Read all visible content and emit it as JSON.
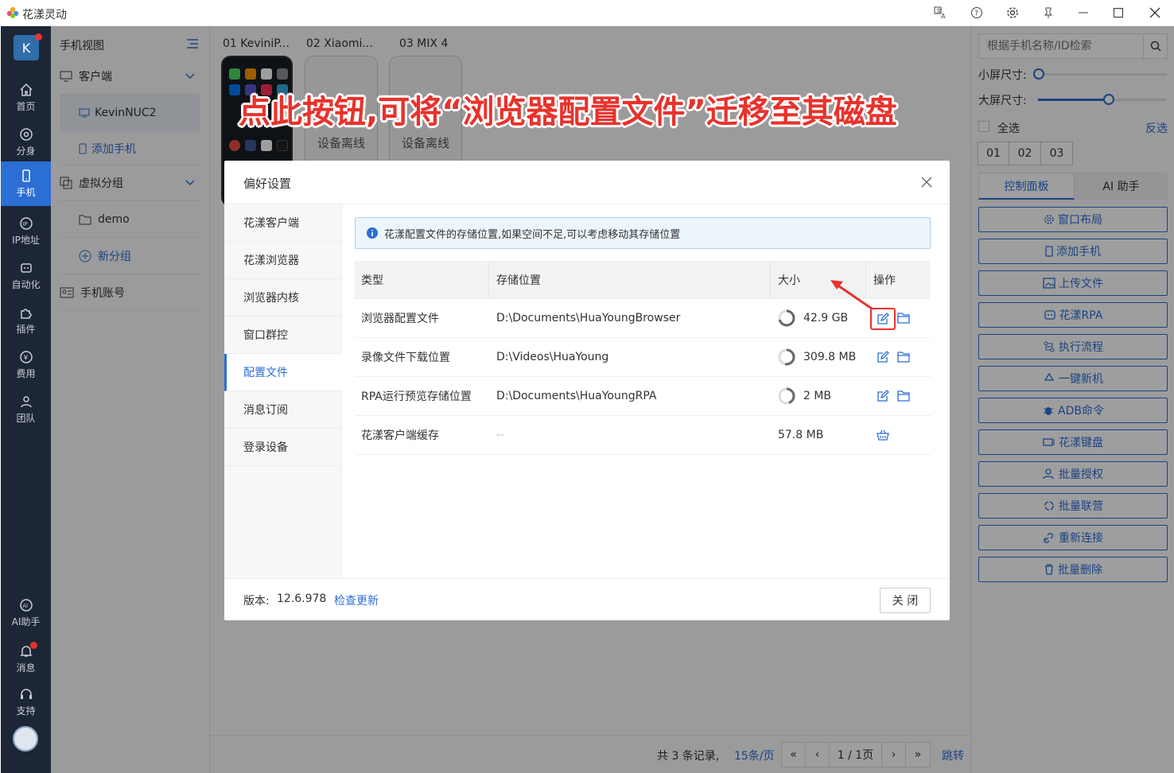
{
  "app": {
    "title": "花漾灵动"
  },
  "nav": {
    "avatar_letter": "K",
    "items": [
      {
        "label": "首页",
        "icon": "home-icon"
      },
      {
        "label": "分身",
        "icon": "chrome-icon"
      },
      {
        "label": "手机",
        "icon": "phone-icon"
      },
      {
        "label": "IP地址",
        "icon": "ip-icon"
      },
      {
        "label": "自动化",
        "icon": "robot-icon"
      },
      {
        "label": "插件",
        "icon": "puzzle-icon"
      },
      {
        "label": "费用",
        "icon": "yen-icon"
      },
      {
        "label": "团队",
        "icon": "team-icon"
      }
    ],
    "bottom": [
      {
        "label": "AI助手",
        "icon": "ai-icon"
      },
      {
        "label": "消息",
        "icon": "bell-icon"
      },
      {
        "label": "支持",
        "icon": "headset-icon"
      }
    ]
  },
  "group": {
    "title": "手机视图",
    "client": "客户端",
    "client_item": "KevinNUC2",
    "add_phone": "添加手机",
    "virtual_group": "虚拟分组",
    "demo": "demo",
    "new_group": "新分组",
    "phone_account": "手机账号"
  },
  "main": {
    "devices": [
      {
        "tab": "01  KeviniP...",
        "status": ""
      },
      {
        "tab": "02  Xiaomi...",
        "status": "设备离线"
      },
      {
        "tab": "03  MIX 4",
        "status": "设备离线"
      }
    ],
    "pagination": {
      "summary": "共 3 条记录,",
      "per_page": "15条/页",
      "page": "1 / 1页",
      "jump": "跳转"
    }
  },
  "right": {
    "search_placeholder": "根据手机名称/ID检索",
    "small_size": "小屏尺寸:",
    "large_size": "大屏尺寸:",
    "select_all": "全选",
    "invert": "反选",
    "tags": [
      "01",
      "02",
      "03"
    ],
    "tabs": [
      "控制面板",
      "AI 助手"
    ],
    "buttons": [
      "窗口布局",
      "添加手机",
      "上传文件",
      "花漾RPA",
      "执行流程",
      "一键新机",
      "ADB命令",
      "花漾键盘",
      "批量授权",
      "批量联营",
      "重新连接",
      "批量删除"
    ]
  },
  "modal": {
    "title": "偏好设置",
    "menu": [
      "花漾客户端",
      "花漾浏览器",
      "浏览器内核",
      "窗口群控",
      "配置文件",
      "消息订阅",
      "登录设备"
    ],
    "active_menu": "配置文件",
    "notice": "花漾配置文件的存储位置,如果空间不足,可以考虑移动其存储位置",
    "headers": [
      "类型",
      "存储位置",
      "大小",
      "操作"
    ],
    "rows": [
      {
        "type": "浏览器配置文件",
        "path": "D:\\Documents\\HuaYoungBrowser",
        "size": "42.9 GB"
      },
      {
        "type": "录像文件下载位置",
        "path": "D:\\Videos\\HuaYoung",
        "size": "309.8 MB"
      },
      {
        "type": "RPA运行预览存储位置",
        "path": "D:\\Documents\\HuaYoungRPA",
        "size": "2 MB"
      },
      {
        "type": "花漾客户端缓存",
        "path": "--",
        "size": "57.8 MB"
      }
    ],
    "version_label": "版本:",
    "version": "12.6.978",
    "check_update": "检查更新",
    "close": "关 闭"
  },
  "annotation": {
    "text": "点此按钮,可将“浏览器配置文件”迁移至其磁盘"
  },
  "colors": {
    "accent": "#2b6ed4",
    "nav_bg": "#1c2635",
    "annotation": "#e8322c"
  }
}
